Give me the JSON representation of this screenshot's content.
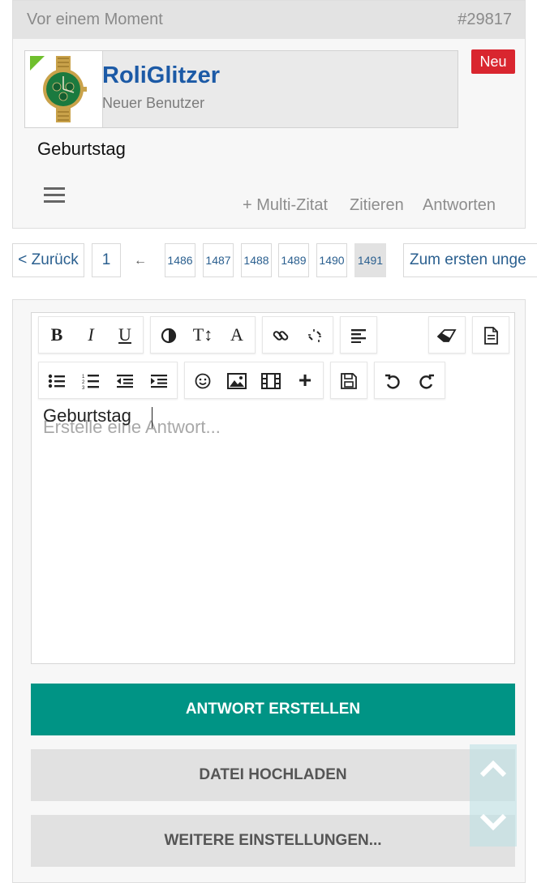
{
  "post": {
    "time": "Vor einem Moment",
    "number": "#29817",
    "badge": "Neu",
    "user": {
      "name": "RoliGlitzer",
      "role": "Neuer Benutzer"
    },
    "text": "Geburtstag",
    "actions": {
      "multi_quote": "+ Multi-Zitat",
      "quote": "Zitieren",
      "reply": "Antworten"
    }
  },
  "pagination": {
    "prev": "< Zurück",
    "first": "1",
    "ellipsis_arrow": "←",
    "pages": [
      "1486",
      "1487",
      "1488",
      "1489",
      "1490",
      "1491"
    ],
    "current": "1491",
    "first_unread": "Zum ersten unge"
  },
  "editor": {
    "value": "Geburtstag",
    "placeholder": "Erstelle eine Antwort...",
    "toolbar_row1": [
      "bold-icon",
      "italic-icon",
      "underline-icon",
      "color-icon",
      "font-size-icon",
      "font-icon",
      "link-icon",
      "unlink-icon",
      "align-icon",
      "eraser-icon",
      "source-icon"
    ],
    "toolbar_row2": [
      "bullet-list-icon",
      "numbered-list-icon",
      "outdent-icon",
      "indent-icon",
      "smiley-icon",
      "image-icon",
      "media-icon",
      "insert-icon",
      "save-draft-icon",
      "undo-icon",
      "redo-icon"
    ]
  },
  "buttons": {
    "submit": "ANTWORT ERSTELLEN",
    "upload": "DATEI HOCHLADEN",
    "more": "WEITERE EINSTELLUNGEN..."
  },
  "colors": {
    "accent": "#009485",
    "username": "#1c5aa6",
    "badge": "#d9262f",
    "link": "#2a5f8f"
  }
}
